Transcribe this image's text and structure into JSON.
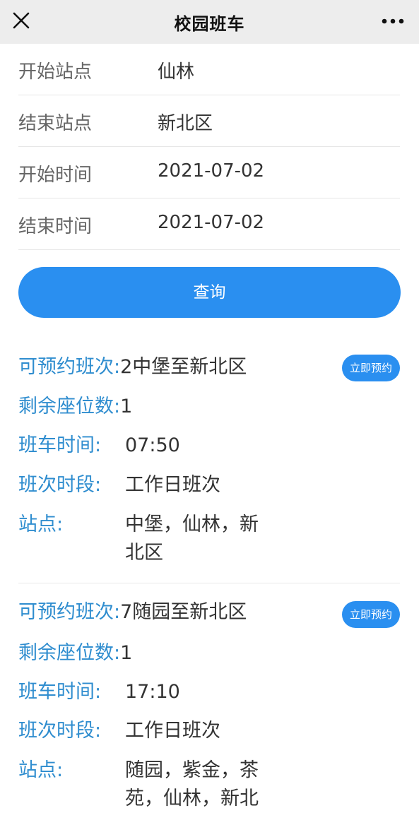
{
  "header": {
    "title": "校园班车",
    "close_icon": "close-icon",
    "more_icon": "more-icon"
  },
  "form": {
    "start_station": {
      "label": "开始站点",
      "value": "仙林"
    },
    "end_station": {
      "label": "结束站点",
      "value": "新北区"
    },
    "start_time": {
      "label": "开始时间",
      "value": "2021-07-02"
    },
    "end_time": {
      "label": "结束时间",
      "value": "2021-07-02"
    },
    "query_label": "查询"
  },
  "labels": {
    "route": "可预约班次:",
    "seats": "剩余座位数:",
    "time": "班车时间:",
    "period": "班次时段:",
    "stops": "站点:",
    "reserve": "立即预约"
  },
  "results": [
    {
      "route": "2中堡至新北区",
      "seats": "1",
      "time": "07:50",
      "period": "工作日班次",
      "stops": "中堡，仙林，新北区"
    },
    {
      "route": "7随园至新北区",
      "seats": "1",
      "time": "17:10",
      "period": "工作日班次",
      "stops": "随园，紫金，茶苑，仙林，新北"
    }
  ],
  "colors": {
    "accent": "#2a8ff0",
    "label_blue": "#2f8dcf",
    "topbar": "#ededed"
  }
}
